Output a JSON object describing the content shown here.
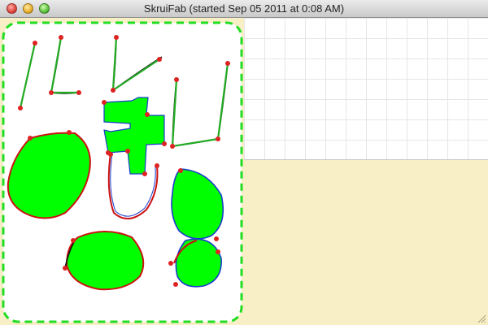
{
  "window": {
    "title": "SkruiFab (started Sep 05 2011 at 0:08 AM)"
  },
  "colors": {
    "fill": "#00ff00",
    "stroke_green": "#22aa22",
    "stroke_black": "#111111",
    "stroke_red": "#cc1111",
    "stroke_blue": "#1a3ccc",
    "control_point": "#dd2222",
    "selection_border": "#22dd22",
    "background": "#f8efc6"
  },
  "icons": {
    "close": "close-button-icon",
    "minimize": "minimize-button-icon",
    "maximize": "zoom-button-icon",
    "resize": "resize-grip-icon"
  }
}
